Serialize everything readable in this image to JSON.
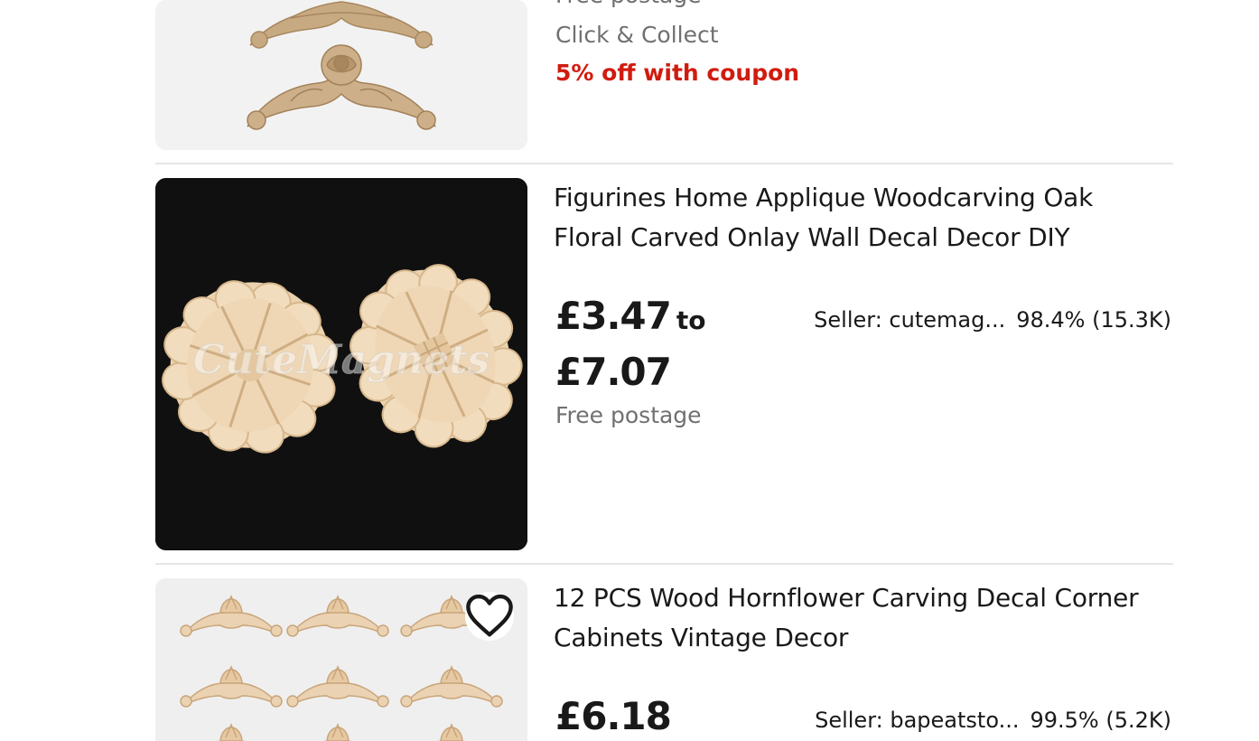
{
  "listings": [
    {
      "shipping": "Free postage",
      "pickup": "Click & Collect",
      "coupon": "5% off with coupon",
      "image_icon": "rose-corner-applique-image"
    },
    {
      "title_line1": "Figurines Home Applique Woodcarving Oak",
      "title_line2": "Floral Carved Onlay Wall Decal Decor DIY",
      "price_low": "£3.47",
      "price_to": "to",
      "price_high": "£7.07",
      "shipping": "Free postage",
      "seller_name": "Seller: cutemag...",
      "seller_feedback": "98.4% (15.3K)",
      "watermark": "CuteMagnets",
      "image_icon": "oval-flower-onlay-image"
    },
    {
      "title_line1": "12 PCS Wood Hornflower Carving Decal Corner",
      "title_line2": "Cabinets Vintage Decor",
      "price": "£6.18",
      "seller_name": "Seller: bapeatsto...",
      "seller_feedback": "99.5% (5.2K)",
      "watchlist_icon": "heart-icon",
      "image_icon": "hornflower-corner-carvings-image"
    }
  ],
  "colors": {
    "coupon_red": "#d11b0f",
    "muted_gray": "#707070",
    "divider": "#e5e5e5",
    "wood": "#e8cfae"
  }
}
